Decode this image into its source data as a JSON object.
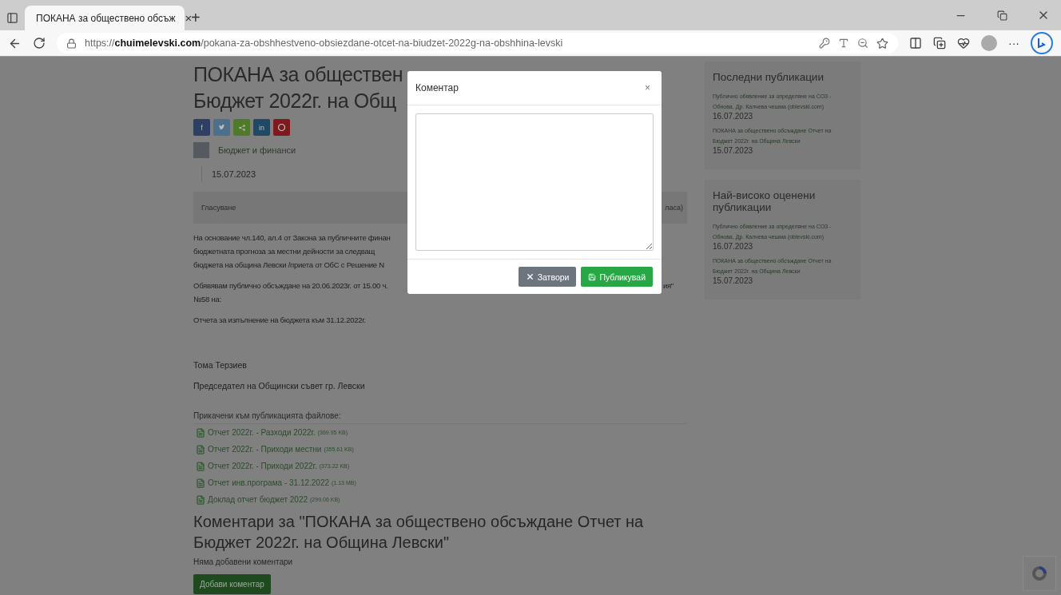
{
  "browser": {
    "tab": {
      "title": "ПОКАНА за обществено обсъж",
      "close": "×",
      "selected": true
    },
    "new_tab": "+",
    "url": "https://**chuimelevski.com**/pokana-za-obshhestveno-obsiezdane-otcet-na-biudzet-2022g-na-obshhina-levski",
    "more": "···"
  },
  "article": {
    "title_lines": [
      "ПОКАНА за обществен",
      "Бюджет 2022г. на Общ"
    ],
    "share_buttons": [
      {
        "kind": "facebook",
        "label": "f"
      },
      {
        "kind": "twitter"
      },
      {
        "kind": "share"
      },
      {
        "kind": "linkedin",
        "label": "in"
      },
      {
        "kind": "pinterest"
      }
    ],
    "category": "Бюджет и финанси",
    "date": "15.07.2023",
    "voting": {
      "label": "Гласуване",
      "tail": "ласа)"
    },
    "paragraphs": [
      {
        "lines": [
          {
            "text": "На основание чл.140, ал.4 от Закона за публичните финан"
          },
          {
            "text": "бюджетната прогноза за местни дейности за следващ"
          },
          {
            "text": "бюджета на община Левски /приета от ОбС с Решение N"
          }
        ]
      },
      {
        "lines": [
          {
            "text": "Обявявам публично обсъждане на 20.06.2023г. от 15.00 ч.",
            "tail": "ия\""
          },
          {
            "text": "№58 на:"
          }
        ]
      },
      {
        "lines": [
          {
            "text": "Отчета за изпълнение на бюджета към 31.12.2022г."
          }
        ]
      }
    ],
    "signature": {
      "name": "Тома Терзиев",
      "role": "Председател на Общински съвет гр. Левски"
    },
    "attachments": {
      "heading": "Прикачени към публикацията файлове:",
      "files": [
        {
          "name": "Отчет 2022г. - Разходи 2022г.",
          "size": "(369.95 KB)"
        },
        {
          "name": "Отчет 2022г. - Приходи местни",
          "size": "(355.61 KB)"
        },
        {
          "name": "Отчет 2022г. - Приходи 2022г.",
          "size": "(373.22 KB)"
        },
        {
          "name": "Отчет инв.програма - 31.12.2022",
          "size": "(1.13 MB)"
        },
        {
          "name": "Доклад отчет бюджет 2022",
          "size": "(299.06 KB)"
        }
      ]
    },
    "comments": {
      "heading": "Коментари за \"ПОКАНА за обществено обсъждане Отчет на Бюджет 2022г. на Община Левски\"",
      "empty_text": "Няма добавени коментари",
      "add_button": "Добави коментар"
    }
  },
  "sidebar": [
    {
      "heading": "Последни публикации",
      "items": [
        {
          "link": "Публично обявление за определяне на СОЗ - Обнова, Др. Калчева чешма (oblevski.com)",
          "date": "16.07.2023"
        },
        {
          "link": "ПОКАНА за обществено обсъждане Отчет на Бюджет 2022г. на Община Левски",
          "date": "15.07.2023"
        }
      ]
    },
    {
      "heading": "Най-високо оценени публикации",
      "items": [
        {
          "link": "Публично обявление за определяне на СОЗ - Обнова, Др. Калчева чешма (oblevski.com)",
          "date": "16.07.2023"
        },
        {
          "link": "ПОКАНА за обществено обсъждане Отчет на Бюджет 2022г. на Община Левски",
          "date": "15.07.2023"
        }
      ]
    }
  ],
  "modal": {
    "title": "Коментар",
    "close": "×",
    "buttons": [
      {
        "label": "Затвори",
        "kind": "secondary"
      },
      {
        "label": "Публикувай",
        "kind": "primary"
      }
    ]
  }
}
